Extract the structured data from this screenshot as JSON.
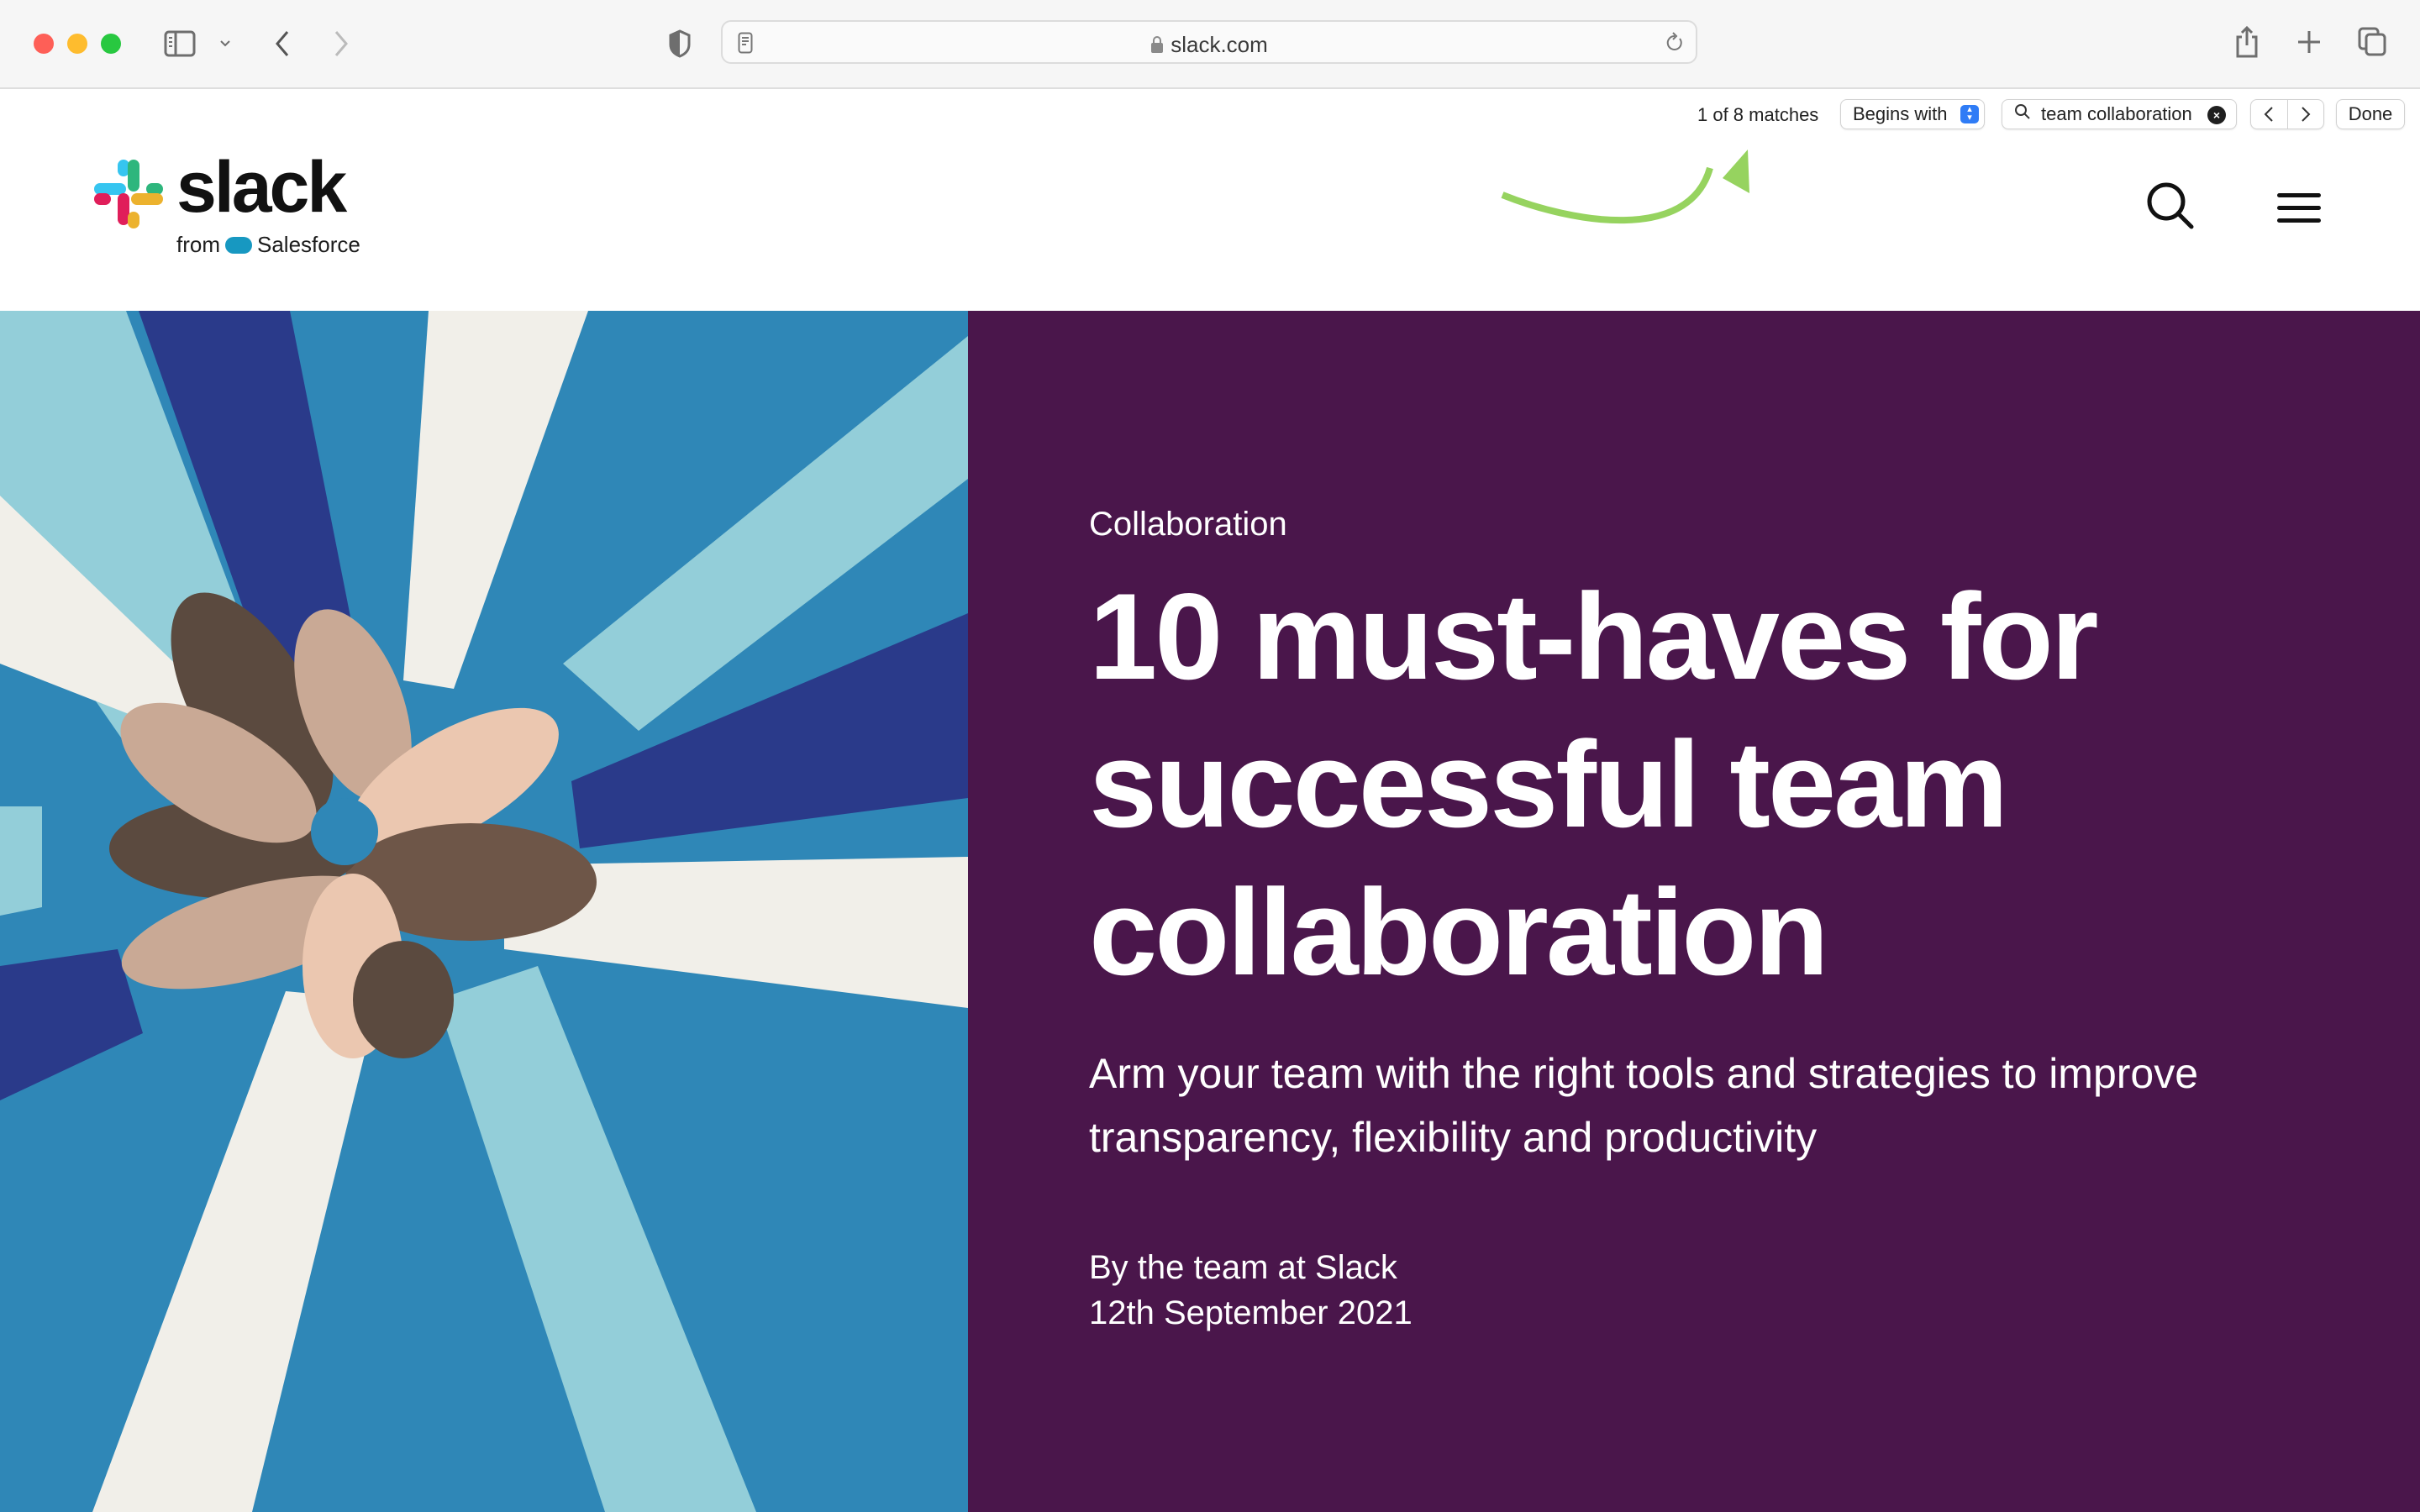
{
  "browser": {
    "url": "slack.com",
    "icons": [
      "sidebar-icon",
      "chevron-down-icon",
      "back-icon",
      "forward-icon",
      "privacy-shield-icon",
      "reader-icon",
      "lock-icon",
      "reload-icon",
      "share-icon",
      "new-tab-icon",
      "tab-overview-icon"
    ]
  },
  "find_bar": {
    "match_count": "1 of 8 matches",
    "mode": "Begins with",
    "query": "team collaboration",
    "prev_label": "‹",
    "next_label": "›",
    "done_label": "Done"
  },
  "site": {
    "logo_word": "slack",
    "logo_from": "from",
    "logo_parent": "Salesforce",
    "colors": {
      "hero_panel": "#4a164b",
      "annotation_arrow": "#96d35f",
      "logo_blue": "#36c5f0",
      "logo_green": "#2eb67d",
      "logo_red": "#e01e5a",
      "logo_yellow": "#ecb22e"
    }
  },
  "hero": {
    "category": "Collaboration",
    "title": "10 must-haves for successful team collaboration",
    "subtitle": "Arm your team with the right tools and strategies to improve transparency, flexibility and productivity",
    "author": "By the team at Slack",
    "date": "12th September 2021",
    "image_alt": "Illustration of many hands joined together in a circle"
  }
}
